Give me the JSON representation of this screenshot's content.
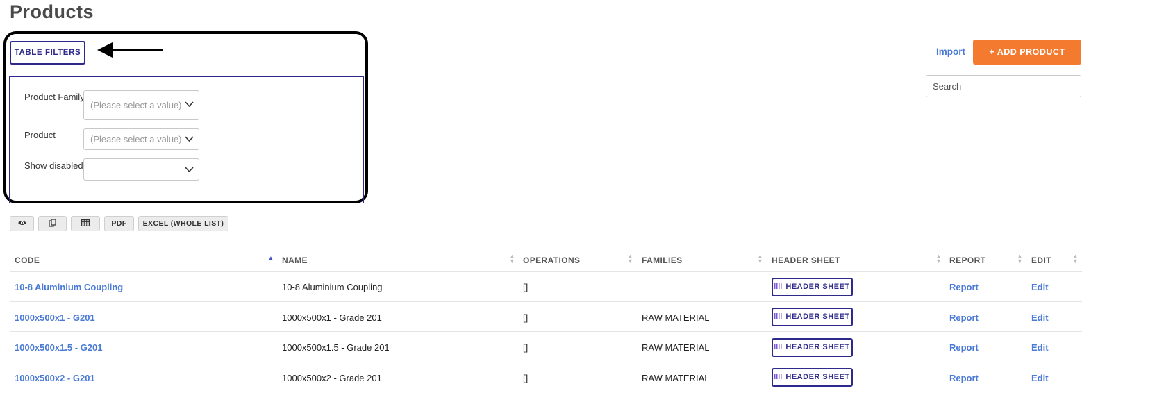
{
  "page": {
    "title": "Products"
  },
  "filters": {
    "toggle_label": "TABLE FILTERS",
    "fields": [
      {
        "label": "Product Family",
        "value": "(Please select a value)"
      },
      {
        "label": "Product",
        "value": "(Please select a value)"
      },
      {
        "label": "Show disabled",
        "value": ""
      }
    ]
  },
  "header_actions": {
    "import_label": "Import",
    "add_label": "+ ADD PRODUCT"
  },
  "search": {
    "placeholder": "Search"
  },
  "toolbar": {
    "buttons": [
      {
        "icon": "eye-icon",
        "label": ""
      },
      {
        "icon": "copy-icon",
        "label": ""
      },
      {
        "icon": "table-icon",
        "label": ""
      },
      {
        "icon": "",
        "label": "PDF"
      },
      {
        "icon": "",
        "label": "EXCEL (WHOLE LIST)"
      }
    ]
  },
  "table": {
    "columns": [
      "CODE",
      "NAME",
      "OPERATIONS",
      "FAMILIES",
      "HEADER SHEET",
      "REPORT",
      "EDIT"
    ],
    "sorted_column": "CODE",
    "sort_direction": "ascending",
    "rows": [
      {
        "code": "10-8 Aluminium Coupling",
        "name": "10-8 Aluminium Coupling",
        "operations": "[]",
        "families": "",
        "header_sheet": "HEADER SHEET",
        "report": "Report",
        "edit": "Edit"
      },
      {
        "code": "1000x500x1 - G201",
        "name": "1000x500x1 - Grade 201",
        "operations": "[]",
        "families": "RAW MATERIAL",
        "header_sheet": "HEADER SHEET",
        "report": "Report",
        "edit": "Edit"
      },
      {
        "code": "1000x500x1.5 - G201",
        "name": "1000x500x1.5 - Grade 201",
        "operations": "[]",
        "families": "RAW MATERIAL",
        "header_sheet": "HEADER SHEET",
        "report": "Report",
        "edit": "Edit"
      },
      {
        "code": "1000x500x2 - G201",
        "name": "1000x500x2 - Grade 201",
        "operations": "[]",
        "families": "RAW MATERIAL",
        "header_sheet": "HEADER SHEET",
        "report": "Report",
        "edit": "Edit"
      }
    ]
  },
  "colors": {
    "brand": "#2e2a8c",
    "accent": "#f47a30",
    "link": "#4a7ad6",
    "annotation": "#000000"
  }
}
